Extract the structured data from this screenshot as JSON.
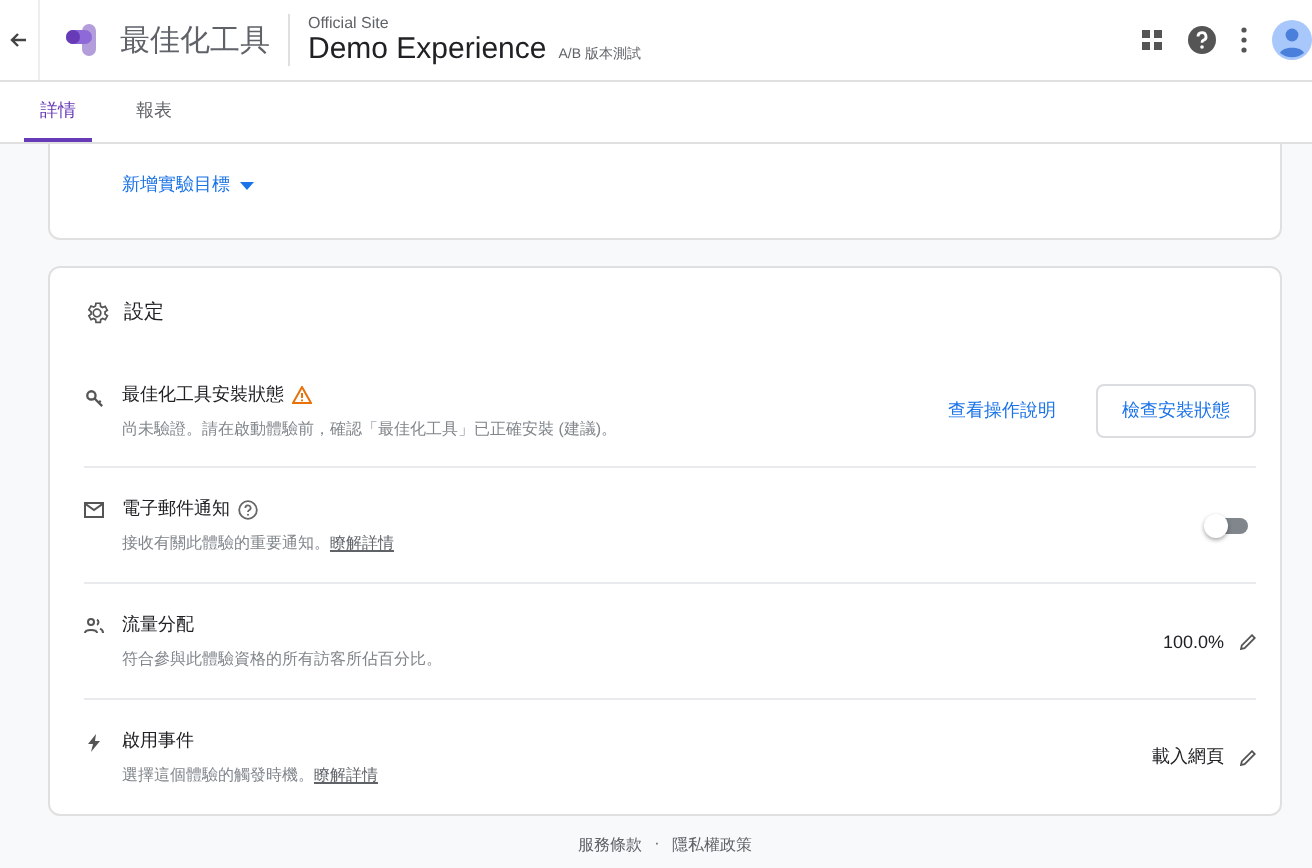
{
  "header": {
    "product": "最佳化工具",
    "container": "Official Site",
    "experience": "Demo Experience",
    "type_badge": "A/B 版本測試"
  },
  "tabs": [
    {
      "label": "詳情",
      "selected": true
    },
    {
      "label": "報表",
      "selected": false
    }
  ],
  "objectives_card": {
    "add_link": "新增實驗目標"
  },
  "settings": {
    "title": "設定",
    "rows": [
      {
        "kind": "action",
        "title": "最佳化工具安裝狀態",
        "description": "尚未驗證。請在啟動體驗前，確認「最佳化工具」已正確安裝 (建議)。",
        "link": "查看操作說明",
        "button": "檢查安裝狀態"
      },
      {
        "kind": "toggle",
        "title": "電子郵件通知",
        "description": "接收有關此體驗的重要通知。",
        "learn_more": "瞭解詳情",
        "on": false
      },
      {
        "kind": "value",
        "title": "流量分配",
        "description": "符合參與此體驗資格的所有訪客所佔百分比。",
        "value": "100.0%"
      },
      {
        "kind": "value",
        "title": "啟用事件",
        "description": "選擇這個體驗的觸發時機。",
        "learn_more": "瞭解詳情",
        "value": "載入網頁"
      }
    ]
  },
  "footer": {
    "links": [
      "服務條款",
      "隱私權政策"
    ],
    "separator": "·"
  }
}
